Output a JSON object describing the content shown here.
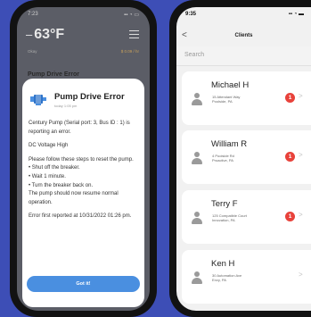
{
  "left_screen": {
    "status_time": "7:23",
    "temperature": "63°F",
    "weather_left": "Okay",
    "weather_right": "$ 0.09 / hr",
    "background_title": "Pump Drive Error",
    "dialog": {
      "title": "Pump Drive Error",
      "time": "today 1:05 pm",
      "paragraph1": "Century Pump (Serial port: 3, Bus ID : 1) is reporting an error.",
      "paragraph2": "DC Voltage High",
      "paragraph3_intro": "Please follow these steps to reset the pump.",
      "steps": [
        "• Shut off the breaker.",
        "• Wait 1 minute.",
        "• Turn the breaker back on."
      ],
      "resume_text": "The pump should now resume normal operation.",
      "reported": "Error first reported at 10/31/2022 01:26 pm.",
      "button_label": "Got it!"
    }
  },
  "right_screen": {
    "status_time": "9:35",
    "back_label": "<",
    "title": "Clients",
    "search_placeholder": "Search",
    "clients": [
      {
        "name": "Michael H",
        "address1": "15 Attendant Way",
        "address2": "Poolside, PA",
        "badge": "1"
      },
      {
        "name": "William R",
        "address1": "4 Poolside Rd",
        "address2": "Proactive, PA",
        "badge": "1"
      },
      {
        "name": "Terry F",
        "address1": "125 Compatible Court",
        "address2": "Innovation, PA",
        "badge": "1"
      },
      {
        "name": "Ken H",
        "address1": "30 Automation Ave",
        "address2": "Envy, PA",
        "badge": ""
      }
    ]
  },
  "colors": {
    "background": "#3d4eb6",
    "button_blue": "#4a8fe0",
    "badge_red": "#e8423b"
  }
}
